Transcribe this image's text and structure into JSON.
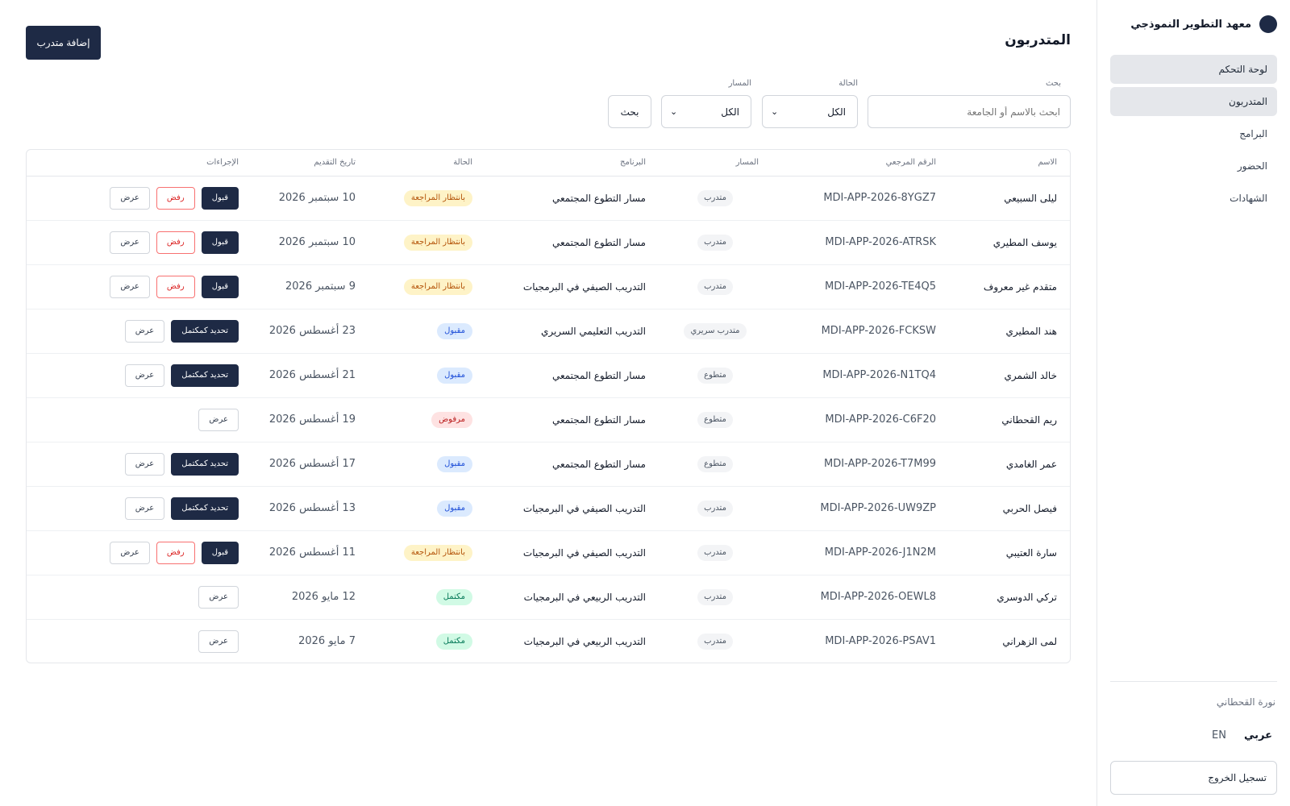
{
  "sidebar": {
    "brand": "معهد التطوير النموذجي",
    "items": [
      {
        "label": "لوحة التحكم"
      },
      {
        "label": "المتدربون"
      },
      {
        "label": "البرامج"
      },
      {
        "label": "الحضور"
      },
      {
        "label": "الشهادات"
      }
    ],
    "user_name": "نورة القحطاني",
    "lang_ar": "عربي",
    "lang_en": "EN",
    "logout": "تسجيل الخروج"
  },
  "header": {
    "title": "المتدربون",
    "add_button": "إضافة متدرب"
  },
  "filters": {
    "search_label": "بحث",
    "search_placeholder": "ابحث بالاسم أو الجامعة",
    "status_label": "الحالة",
    "status_value": "الكل",
    "track_label": "المسار",
    "track_value": "الكل",
    "search_button": "بحث"
  },
  "table": {
    "headers": [
      "الاسم",
      "الرقم المرجعي",
      "المسار",
      "البرنامج",
      "الحالة",
      "تاريخ التقديم",
      "الإجراءات"
    ],
    "action_labels": {
      "accept": "قبول",
      "reject": "رفض",
      "view": "عرض",
      "complete": "تحديد كمكتمل"
    },
    "rows": [
      {
        "name": "ليلى السبيعي",
        "ref": "MDI-APP-2026-8YGZ7",
        "track": "متدرب",
        "program": "مسار التطوع المجتمعي",
        "status": "بانتظار المراجعة",
        "status_type": "pending",
        "date": "10 سبتمبر 2026",
        "actions": [
          "accept",
          "reject",
          "view"
        ]
      },
      {
        "name": "يوسف المطيري",
        "ref": "MDI-APP-2026-ATRSK",
        "track": "متدرب",
        "program": "مسار التطوع المجتمعي",
        "status": "بانتظار المراجعة",
        "status_type": "pending",
        "date": "10 سبتمبر 2026",
        "actions": [
          "accept",
          "reject",
          "view"
        ]
      },
      {
        "name": "متقدم غير معروف",
        "ref": "MDI-APP-2026-TE4Q5",
        "track": "متدرب",
        "program": "التدريب الصيفي في البرمجيات",
        "status": "بانتظار المراجعة",
        "status_type": "pending",
        "date": "9 سبتمبر 2026",
        "actions": [
          "accept",
          "reject",
          "view"
        ]
      },
      {
        "name": "هند المطيري",
        "ref": "MDI-APP-2026-FCKSW",
        "track": "متدرب سريري",
        "program": "التدريب التعليمي السريري",
        "status": "مقبول",
        "status_type": "accepted",
        "date": "23 أغسطس 2026",
        "actions": [
          "complete",
          "view"
        ]
      },
      {
        "name": "خالد الشمري",
        "ref": "MDI-APP-2026-N1TQ4",
        "track": "متطوع",
        "program": "مسار التطوع المجتمعي",
        "status": "مقبول",
        "status_type": "accepted",
        "date": "21 أغسطس 2026",
        "actions": [
          "complete",
          "view"
        ]
      },
      {
        "name": "ريم القحطاني",
        "ref": "MDI-APP-2026-C6F20",
        "track": "متطوع",
        "program": "مسار التطوع المجتمعي",
        "status": "مرفوض",
        "status_type": "rejected",
        "date": "19 أغسطس 2026",
        "actions": [
          "view"
        ]
      },
      {
        "name": "عمر الغامدي",
        "ref": "MDI-APP-2026-T7M99",
        "track": "متطوع",
        "program": "مسار التطوع المجتمعي",
        "status": "مقبول",
        "status_type": "accepted",
        "date": "17 أغسطس 2026",
        "actions": [
          "complete",
          "view"
        ]
      },
      {
        "name": "فيصل الحربي",
        "ref": "MDI-APP-2026-UW9ZP",
        "track": "متدرب",
        "program": "التدريب الصيفي في البرمجيات",
        "status": "مقبول",
        "status_type": "accepted",
        "date": "13 أغسطس 2026",
        "actions": [
          "complete",
          "view"
        ]
      },
      {
        "name": "سارة العتيبي",
        "ref": "MDI-APP-2026-J1N2M",
        "track": "متدرب",
        "program": "التدريب الصيفي في البرمجيات",
        "status": "بانتظار المراجعة",
        "status_type": "pending",
        "date": "11 أغسطس 2026",
        "actions": [
          "accept",
          "reject",
          "view"
        ]
      },
      {
        "name": "تركي الدوسري",
        "ref": "MDI-APP-2026-OEWL8",
        "track": "متدرب",
        "program": "التدريب الربيعي في البرمجيات",
        "status": "مكتمل",
        "status_type": "complete",
        "date": "12 مايو 2026",
        "actions": [
          "view"
        ]
      },
      {
        "name": "لمى الزهراني",
        "ref": "MDI-APP-2026-PSAV1",
        "track": "متدرب",
        "program": "التدريب الربيعي في البرمجيات",
        "status": "مكتمل",
        "status_type": "complete",
        "date": "7 مايو 2026",
        "actions": [
          "view"
        ]
      }
    ]
  },
  "colors": {
    "primary": "#1e2a45",
    "pending_bg": "#fef3c7",
    "accepted_bg": "#dbeafe",
    "rejected_bg": "#fee2e2",
    "complete_bg": "#d1fae5"
  }
}
